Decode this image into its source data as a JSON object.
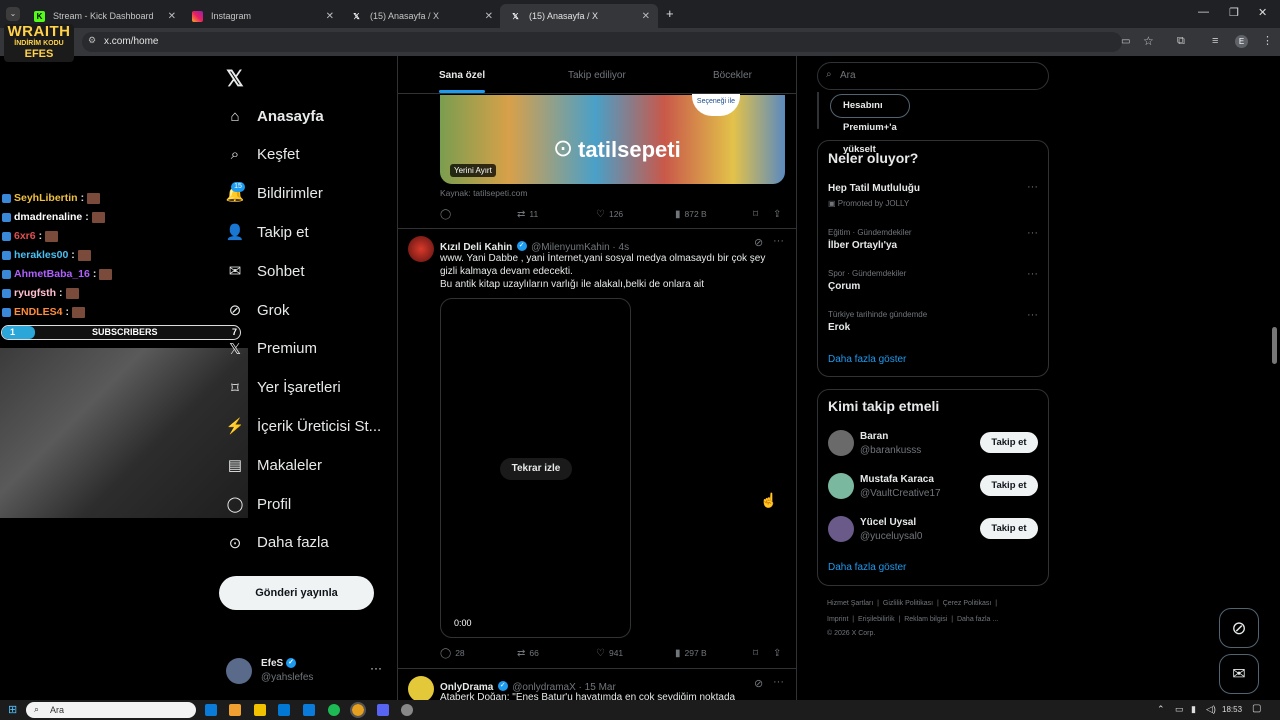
{
  "browser": {
    "tabs": [
      {
        "title": "Stream - Kick Dashboard",
        "active": false
      },
      {
        "title": "Instagram",
        "active": false
      },
      {
        "title": "(15) Anasayfa / X",
        "active": false
      },
      {
        "title": "(15) Anasayfa / X",
        "active": true
      }
    ],
    "url": "x.com/home"
  },
  "overlay": {
    "logo": {
      "line1": "WRAITH",
      "line2": "İNDİRİM KODU",
      "line3": "EFES"
    },
    "chat": [
      {
        "user": "SeyhLibertin",
        "color": "#f0c040"
      },
      {
        "user": "dmadrenaline",
        "color": "#ffffff"
      },
      {
        "user": "6xr6",
        "color": "#e05050"
      },
      {
        "user": "herakles00",
        "color": "#4ac0f0"
      },
      {
        "user": "AhmetBaba_16",
        "color": "#b060ff"
      },
      {
        "user": "ryugfsth",
        "color": "#ffc0d0"
      },
      {
        "user": "ENDLES4",
        "color": "#ff8c3a"
      }
    ],
    "subscribers": {
      "label": "SUBSCRIBERS",
      "current": "1",
      "goal": "7",
      "progress": 0.14
    }
  },
  "nav": {
    "items": [
      {
        "label": "Anasayfa",
        "icon": "home-icon",
        "bold": true
      },
      {
        "label": "Keşfet",
        "icon": "search-icon"
      },
      {
        "label": "Bildirimler",
        "icon": "bell-icon"
      },
      {
        "label": "Takip et",
        "icon": "person-add-icon"
      },
      {
        "label": "Sohbet",
        "icon": "mail-icon"
      },
      {
        "label": "Grok",
        "icon": "grok-icon"
      },
      {
        "label": "Premium",
        "icon": "x-premium-icon"
      },
      {
        "label": "Yer İşaretleri",
        "icon": "bookmark-icon"
      },
      {
        "label": "İçerik Üreticisi St...",
        "icon": "studio-icon"
      },
      {
        "label": "Makaleler",
        "icon": "article-icon"
      },
      {
        "label": "Profil",
        "icon": "profile-icon"
      },
      {
        "label": "Daha fazla",
        "icon": "more-circle-icon"
      }
    ],
    "notification_count": "15",
    "post_button": "Gönderi yayınla",
    "account": {
      "name": "EfeS",
      "handle": "@yahslefes",
      "more": "···"
    }
  },
  "feed": {
    "tabs": [
      "Sana özel",
      "Takip ediliyor",
      "Böcekler"
    ],
    "ad": {
      "brand": "tatilsepeti",
      "badge": "Yerini Ayırt",
      "corner": "Seçeneği ile",
      "source": "Kaynak: tatilsepeti.com",
      "replies": "",
      "reposts": "11",
      "likes": "126",
      "views": "872 B"
    },
    "tweets": [
      {
        "name": "Kızıl Deli Kahin",
        "handle": "@MilenyumKahin · 4s",
        "lines": [
          "www. Yani Dabbe , yani İnternet,yani sosyal medya olmasaydı bir çok şey",
          "gizli kalmaya devam edecekti.",
          "Bu antik kitap uzaylıların varlığı ile alakalı,belki de onlara ait"
        ],
        "video_button": "Tekrar izle",
        "video_time": "0:00",
        "replies": "28",
        "reposts": "66",
        "likes": "941",
        "views": "297 B"
      },
      {
        "name": "OnlyDrama",
        "handle": "@onlydramaX · 15 Mar",
        "lines": [
          "Ataberk Doğan: \"Enes Batur'u hayatımda en çok sevdiğim noktada"
        ]
      }
    ]
  },
  "sidebar": {
    "search_placeholder": "Ara",
    "premium_button": "Hesabını Premium+'a yükselt",
    "trends_title": "Neler oluyor?",
    "trends": [
      {
        "category": "",
        "name": "Hep Tatil Mutluluğu",
        "sub": "Promoted by JOLLY"
      },
      {
        "category": "Eğitim · Gündemdekiler",
        "name": "İlber Ortaylı'ya",
        "sub": ""
      },
      {
        "category": "Spor · Gündemdekiler",
        "name": "Çorum",
        "sub": ""
      },
      {
        "category": "Türkiye tarihinde gündemde",
        "name": "Erok",
        "sub": ""
      }
    ],
    "show_more": "Daha fazla göster",
    "who_to_follow_title": "Kimi takip etmeli",
    "suggestions": [
      {
        "name": "Baran",
        "handle": "@barankusss",
        "button": "Takip et",
        "color": "#6a6a6a"
      },
      {
        "name": "Mustafa Karaca",
        "handle": "@VaultCreative17",
        "button": "Takip et",
        "color": "#7ab8a0"
      },
      {
        "name": "Yücel Uysal",
        "handle": "@yuceluysal0",
        "button": "Takip et",
        "color": "#6a5a8a"
      }
    ],
    "footer_links": [
      "Hizmet Şartları",
      "Gizlilik Politikası",
      "Çerez Politikası",
      "Imprint",
      "Erişilebilirlik",
      "Reklam bilgisi",
      "Daha fazla ..."
    ],
    "copyright": "© 2026 X Corp."
  },
  "taskbar": {
    "search": "Ara",
    "time": "18:53"
  }
}
